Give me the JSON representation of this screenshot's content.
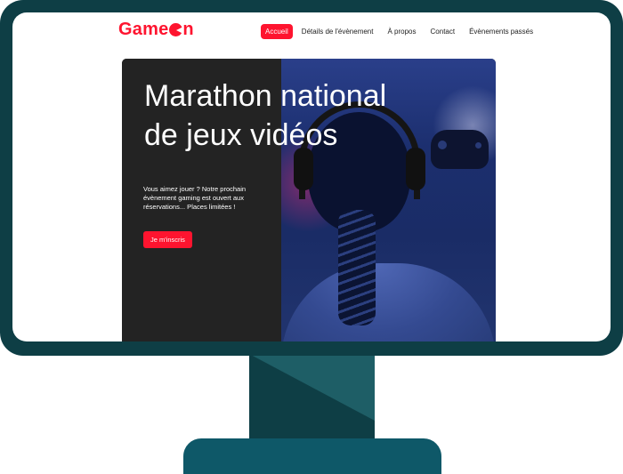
{
  "brand": {
    "logo_text": "Game",
    "color": "#fe142f"
  },
  "nav": {
    "items": [
      {
        "label": "Accueil",
        "active": true
      },
      {
        "label": "Détails de l'évènement"
      },
      {
        "label": "À propos"
      },
      {
        "label": "Contact"
      },
      {
        "label": "Évènements passés"
      }
    ]
  },
  "hero": {
    "title": "Marathon national\nde jeux vidéos",
    "text": "Vous aimez jouer ? Notre prochain évènement gaming est ouvert aux réservations... Places limitées !",
    "cta_label": "Je m'inscris"
  },
  "colors": {
    "monitor": "#0e3e45",
    "hero_left_bg": "#232323"
  },
  "icons": [
    "power-button-icon"
  ]
}
